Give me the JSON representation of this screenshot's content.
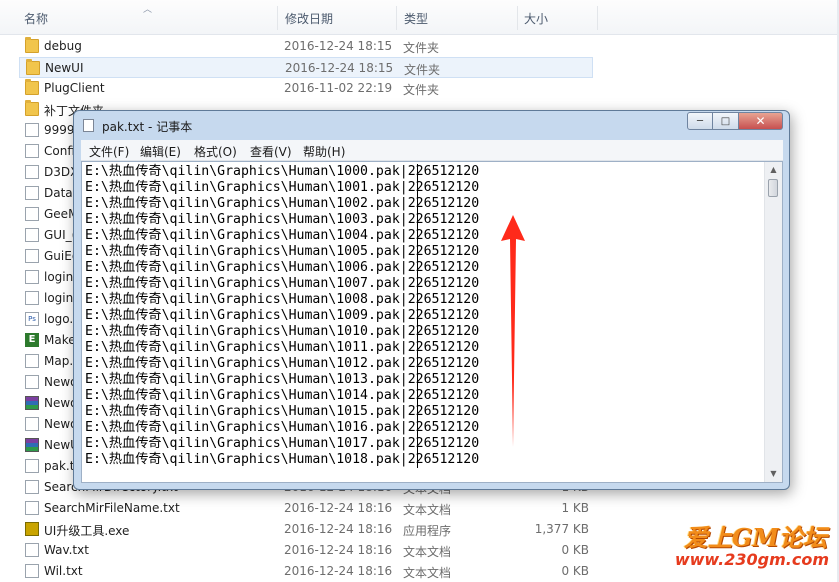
{
  "explorer": {
    "columns": {
      "name": "名称",
      "date": "修改日期",
      "type": "类型",
      "size": "大小"
    },
    "files": [
      {
        "name": "debug",
        "date": "2016-12-24 18:15",
        "type": "文件夹",
        "size": "",
        "icon": "folder-icon"
      },
      {
        "name": "NewUI",
        "date": "2016-12-24 18:15",
        "type": "文件夹",
        "size": "",
        "icon": "folder-icon"
      },
      {
        "name": "PlugClient",
        "date": "2016-11-02 22:19",
        "type": "文件夹",
        "size": "",
        "icon": "folder-icon"
      },
      {
        "name": "补丁文件夹",
        "date": "",
        "type": "",
        "size": "",
        "icon": "folder-icon"
      },
      {
        "name": "9999",
        "date": "",
        "type": "",
        "size": "",
        "icon": "file-icon"
      },
      {
        "name": "Confi",
        "date": "",
        "type": "",
        "size": "",
        "icon": "settings-file-icon"
      },
      {
        "name": "D3DX",
        "date": "",
        "type": "",
        "size": "",
        "icon": "dll-icon"
      },
      {
        "name": "Data.",
        "date": "",
        "type": "",
        "size": "",
        "icon": "file-icon"
      },
      {
        "name": "GeeM",
        "date": "",
        "type": "",
        "size": "",
        "icon": "file-icon"
      },
      {
        "name": "GUI_(",
        "date": "",
        "type": "",
        "size": "",
        "icon": "settings-file-icon"
      },
      {
        "name": "GuiEd",
        "date": "",
        "type": "",
        "size": "",
        "icon": "settings-file-icon"
      },
      {
        "name": "login",
        "date": "",
        "type": "",
        "size": "",
        "icon": "file-icon"
      },
      {
        "name": "login",
        "date": "",
        "type": "",
        "size": "",
        "icon": "file-icon"
      },
      {
        "name": "logo.",
        "date": "",
        "type": "",
        "size": "",
        "icon": "ps-file-icon"
      },
      {
        "name": "Make",
        "date": "",
        "type": "",
        "size": "",
        "icon": "exe-icon"
      },
      {
        "name": "Map.",
        "date": "",
        "type": "",
        "size": "",
        "icon": "file-icon"
      },
      {
        "name": "Newo",
        "date": "",
        "type": "",
        "size": "",
        "icon": "file-icon"
      },
      {
        "name": "Newo",
        "date": "",
        "type": "",
        "size": "",
        "icon": "rar-icon"
      },
      {
        "name": "Newo",
        "date": "",
        "type": "",
        "size": "",
        "icon": "file-icon"
      },
      {
        "name": "NewU",
        "date": "",
        "type": "",
        "size": "",
        "icon": "rar-icon"
      },
      {
        "name": "pak.t",
        "date": "",
        "type": "",
        "size": "",
        "icon": "file-icon"
      },
      {
        "name": "SearchMirDirectory.txt",
        "date": "2016-12-24 18:16",
        "type": "文本文档",
        "size": "1 KB",
        "icon": "file-icon"
      },
      {
        "name": "SearchMirFileName.txt",
        "date": "2016-12-24 18:16",
        "type": "文本文档",
        "size": "1 KB",
        "icon": "file-icon"
      },
      {
        "name": "UI升级工具.exe",
        "date": "2016-12-24 18:16",
        "type": "应用程序",
        "size": "1,377 KB",
        "icon": "ui-tool-icon"
      },
      {
        "name": "Wav.txt",
        "date": "2016-12-24 18:16",
        "type": "文本文档",
        "size": "0 KB",
        "icon": "file-icon"
      },
      {
        "name": "Wil.txt",
        "date": "2016-12-24 18:16",
        "type": "文本文档",
        "size": "0 KB",
        "icon": "file-icon"
      }
    ],
    "selected_index": 1
  },
  "notepad": {
    "title": "pak.txt - 记事本",
    "window_buttons": {
      "minimize": "─",
      "maximize": "□",
      "close": "✕"
    },
    "menu": [
      "文件(F)",
      "编辑(E)",
      "格式(O)",
      "查看(V)",
      "帮助(H)"
    ],
    "lines": [
      "E:\\热血传奇\\qilin\\Graphics\\Human\\1000.pak|226512120",
      "E:\\热血传奇\\qilin\\Graphics\\Human\\1001.pak|226512120",
      "E:\\热血传奇\\qilin\\Graphics\\Human\\1002.pak|226512120",
      "E:\\热血传奇\\qilin\\Graphics\\Human\\1003.pak|226512120",
      "E:\\热血传奇\\qilin\\Graphics\\Human\\1004.pak|226512120",
      "E:\\热血传奇\\qilin\\Graphics\\Human\\1005.pak|226512120",
      "E:\\热血传奇\\qilin\\Graphics\\Human\\1006.pak|226512120",
      "E:\\热血传奇\\qilin\\Graphics\\Human\\1007.pak|226512120",
      "E:\\热血传奇\\qilin\\Graphics\\Human\\1008.pak|226512120",
      "E:\\热血传奇\\qilin\\Graphics\\Human\\1009.pak|226512120",
      "E:\\热血传奇\\qilin\\Graphics\\Human\\1010.pak|226512120",
      "E:\\热血传奇\\qilin\\Graphics\\Human\\1011.pak|226512120",
      "E:\\热血传奇\\qilin\\Graphics\\Human\\1012.pak|226512120",
      "E:\\热血传奇\\qilin\\Graphics\\Human\\1013.pak|226512120",
      "E:\\热血传奇\\qilin\\Graphics\\Human\\1014.pak|226512120",
      "E:\\热血传奇\\qilin\\Graphics\\Human\\1015.pak|226512120",
      "E:\\热血传奇\\qilin\\Graphics\\Human\\1016.pak|226512120",
      "E:\\热血传奇\\qilin\\Graphics\\Human\\1017.pak|226512120",
      "E:\\热血传奇\\qilin\\Graphics\\Human\\1018.pak|226512120"
    ]
  },
  "watermark": {
    "title": "爱上GM论坛",
    "url": "www.230gm.com"
  },
  "colors": {
    "arrow": "#ff2a1a",
    "selection": "#ecf3fb",
    "titlebar": "#c6d9ee"
  }
}
